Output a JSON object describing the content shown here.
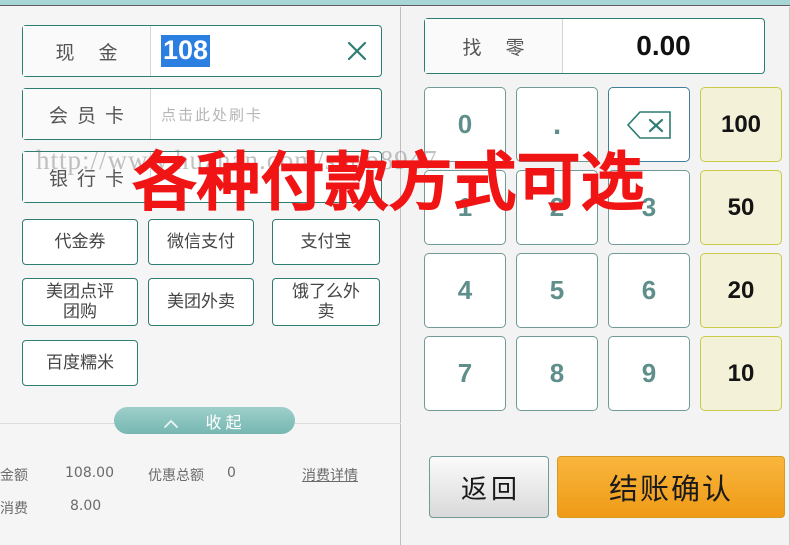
{
  "left": {
    "fields": [
      {
        "label": "现 金",
        "value": "108",
        "selected": true,
        "has_clear": true,
        "clear_icon": "close-icon"
      },
      {
        "label": "会员卡",
        "value": "",
        "placeholder": "点击此处刷卡",
        "selected": false,
        "has_clear": false
      },
      {
        "label": "银行卡",
        "value": "",
        "placeholder": "",
        "selected": false,
        "has_clear": false
      }
    ],
    "payment_methods": [
      {
        "label": "代金券"
      },
      {
        "label": "微信支付"
      },
      {
        "label": "支付宝"
      },
      {
        "label": "美团点评\n团购"
      },
      {
        "label": "美团外卖"
      },
      {
        "label": "饿了么外\n卖"
      },
      {
        "label": "百度糯米"
      }
    ],
    "collapse": {
      "label": "收起",
      "icon": "chevron-up-icon"
    },
    "summary": [
      {
        "label": "账单金额",
        "value": "108.00",
        "label2": "优惠总额",
        "value2": "0",
        "link": "消费详情"
      },
      {
        "label": "酒水消费",
        "value": "8.00",
        "label2": "",
        "value2": "",
        "link": ""
      }
    ]
  },
  "right": {
    "change_field": {
      "label": "找 零",
      "value": "0.00"
    },
    "keypad": [
      [
        "0",
        ".",
        "backspace"
      ],
      [
        "1",
        "2",
        "3"
      ],
      [
        "4",
        "5",
        "6"
      ],
      [
        "7",
        "8",
        "9"
      ]
    ],
    "backspace_icon": "backspace-icon",
    "quick_amounts": [
      "100",
      "50",
      "20",
      "10"
    ],
    "back_button": "返回",
    "confirm_button": "结账确认"
  },
  "watermarks": {
    "url": "http://www.huzhan.com/shop8947",
    "red_text": "各种付款方式可选"
  },
  "colors": {
    "topbar": "#a8d6d6",
    "field_border": "#2e7d72",
    "selection": "#2a7fe0",
    "quick_bg": "#f3f2d8",
    "quick_border": "#c9c94a",
    "confirm_bg": "#f2a42a",
    "collapse_bg": "#76b7b2",
    "watermark_red": "#f01414"
  }
}
